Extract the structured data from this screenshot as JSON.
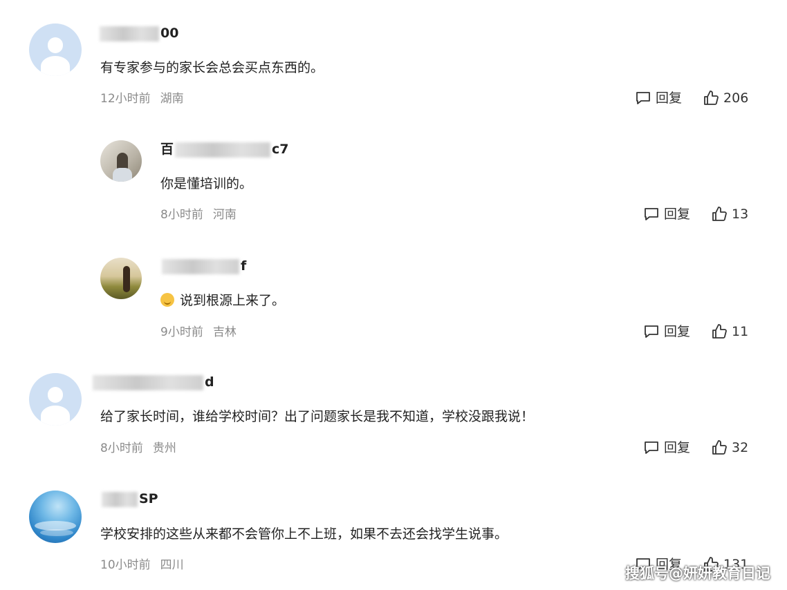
{
  "reply_label": "回复",
  "comments": [
    {
      "user_suffix": "00",
      "user_prefix": "",
      "avatar": "default-user-avatar",
      "text": "有专家参与的家长会总会买点东西的。",
      "time": "12小时前",
      "location": "湖南",
      "likes": "206"
    },
    {
      "user_prefix": "百",
      "user_suffix": "c7",
      "avatar": "photo-avatar-girl",
      "text": "你是懂培训的。",
      "time": "8小时前",
      "location": "河南",
      "likes": "13"
    },
    {
      "user_prefix": "",
      "user_suffix": "f",
      "avatar": "photo-avatar-landscape",
      "emoji": "smile-emoji",
      "text": "说到根源上来了。",
      "time": "9小时前",
      "location": "吉林",
      "likes": "11"
    },
    {
      "user_prefix": "",
      "user_suffix": "d",
      "avatar": "default-user-avatar",
      "text": "给了家长时间，谁给学校时间？出了问题家长是我不知道，学校没跟我说！",
      "time": "8小时前",
      "location": "贵州",
      "likes": "32"
    },
    {
      "user_prefix": "",
      "user_suffix": "SP",
      "avatar": "blue-wave-avatar",
      "text": "学校安排的这些从来都不会管你上不上班，如果不去还会找学生说事。",
      "time": "10小时前",
      "location": "四川",
      "likes": "131"
    }
  ],
  "watermark": "搜狐号@妍妍教育日记",
  "colors": {
    "meta": "#8a8a8a",
    "avatar_default": "#cfe0f4",
    "text": "#222222"
  }
}
